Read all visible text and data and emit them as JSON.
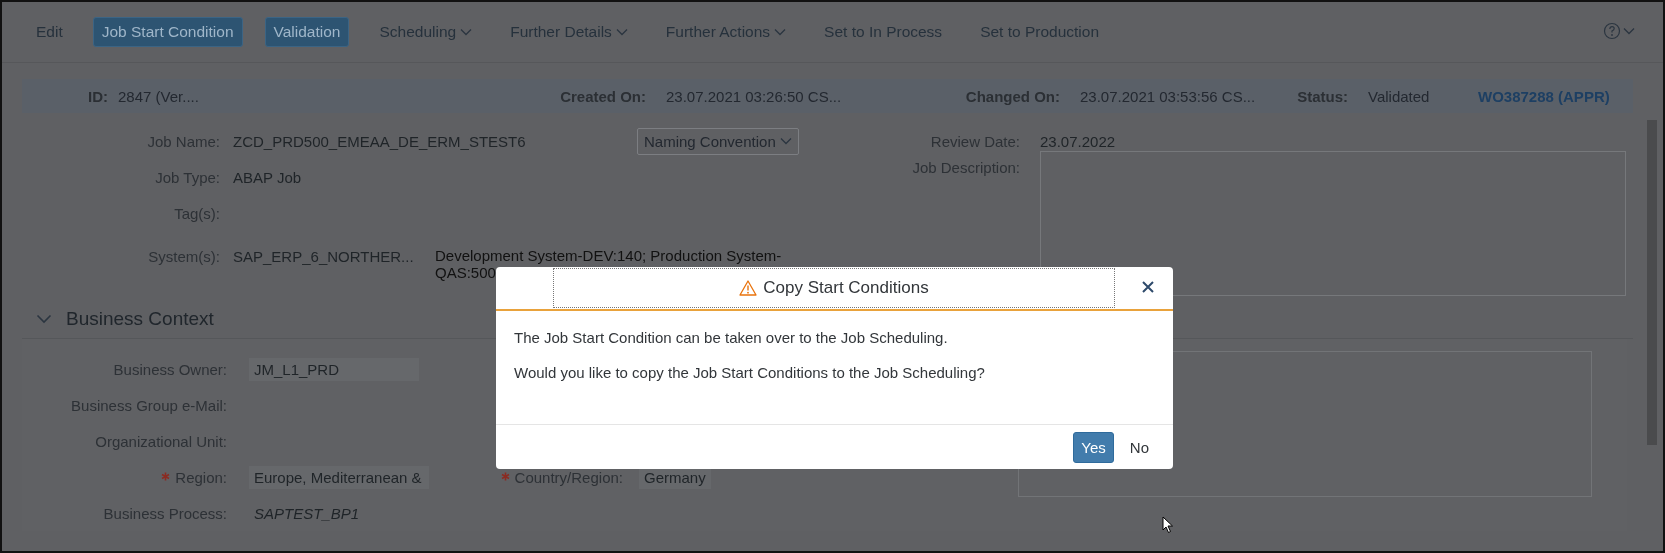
{
  "toolbar": {
    "items": [
      {
        "label": "Edit",
        "kind": "plain"
      },
      {
        "label": "Job Start Condition",
        "kind": "emphasized"
      },
      {
        "label": "Validation",
        "kind": "emphasized"
      },
      {
        "label": "Scheduling",
        "kind": "menu"
      },
      {
        "label": "Further Details",
        "kind": "menu"
      },
      {
        "label": "Further Actions",
        "kind": "menu"
      },
      {
        "label": "Set to In Process",
        "kind": "plain"
      },
      {
        "label": "Set to Production",
        "kind": "plain"
      }
    ]
  },
  "header": {
    "id": {
      "label": "ID:",
      "value": "2847 (Ver...."
    },
    "created_on": {
      "label": "Created On:",
      "value": "23.07.2021 03:26:50 CS..."
    },
    "changed_on": {
      "label": "Changed On:",
      "value": "23.07.2021 03:53:56 CS..."
    },
    "status": {
      "label": "Status:",
      "value": "Validated"
    },
    "link": "WO387288 (APPR)"
  },
  "general": {
    "job_name": {
      "label": "Job Name:",
      "value": "ZCD_PRD500_EMEAA_DE_ERM_STEST6"
    },
    "naming_convention": "Naming Convention",
    "job_type": {
      "label": "Job Type:",
      "value": "ABAP Job"
    },
    "tags": {
      "label": "Tag(s):"
    },
    "systems": {
      "label": "System(s):",
      "value": "SAP_ERP_6_NORTHER...",
      "note": "Development System-DEV:140; Production System-QAS:500"
    },
    "review_date": {
      "label": "Review Date:",
      "value": "23.07.2022"
    },
    "job_description": {
      "label": "Job Description:"
    }
  },
  "business_context": {
    "title": "Business Context",
    "expanded": true,
    "business_owner": {
      "label": "Business Owner:",
      "value": "JM_L1_PRD"
    },
    "business_group_email": {
      "label": "Business Group e-Mail:"
    },
    "organizational_unit": {
      "label": "Organizational Unit:"
    },
    "region": {
      "label": "Region:",
      "value": "Europe, Mediterranean &",
      "required": true
    },
    "country_region": {
      "label": "Country/Region:",
      "value": "Germany",
      "required": true
    },
    "business_process": {
      "label": "Business Process:",
      "value": "SAPTEST_BP1"
    }
  },
  "dialog": {
    "title": "Copy Start Conditions",
    "messages": [
      "The Job Start Condition can be taken over to the Job Scheduling.",
      "Would you like to copy the Job Start Conditions to the Job Scheduling?"
    ],
    "buttons": [
      {
        "label": "Yes",
        "kind": "emphasized"
      },
      {
        "label": "No",
        "kind": "transparent"
      }
    ]
  }
}
